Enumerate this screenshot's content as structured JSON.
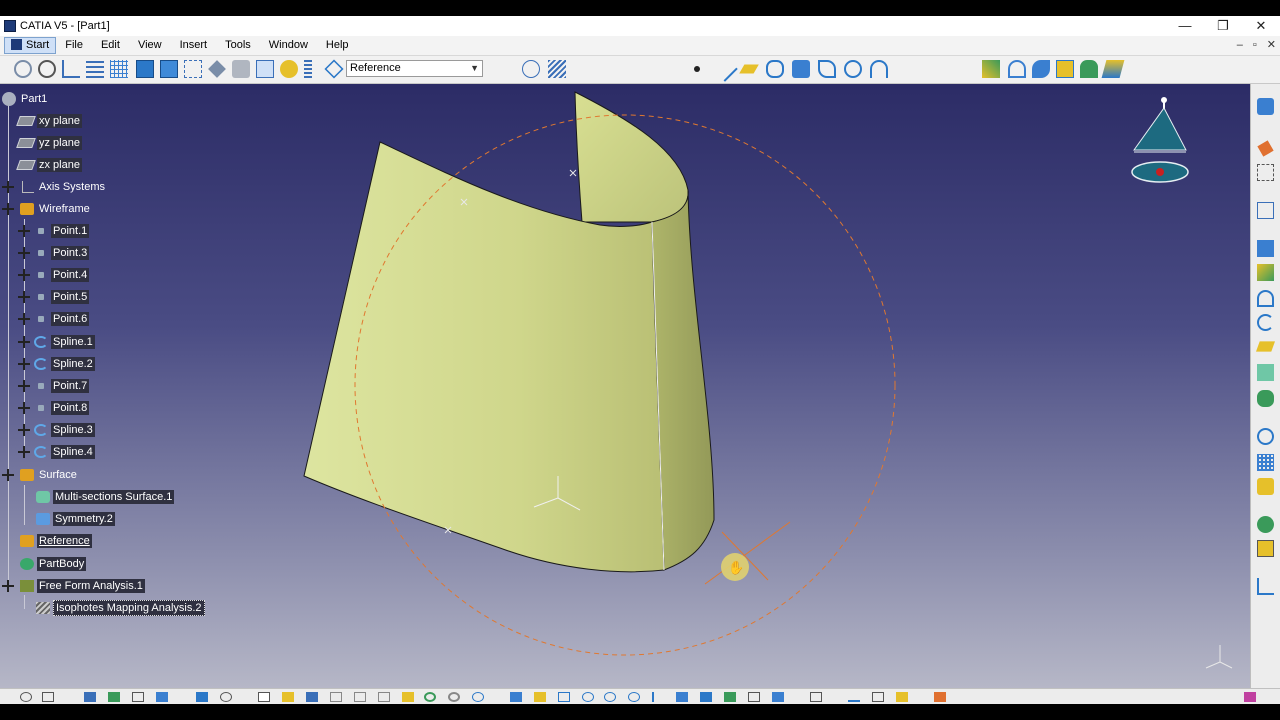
{
  "window": {
    "title": "CATIA V5 - [Part1]",
    "controls": [
      "—",
      "❐",
      "✕"
    ]
  },
  "menu": {
    "items": [
      "Start",
      "File",
      "Edit",
      "View",
      "Insert",
      "Tools",
      "Window",
      "Help"
    ],
    "inner_controls": [
      "–",
      "▫",
      "✕"
    ]
  },
  "toolbar": {
    "reference_select": "Reference"
  },
  "tree": {
    "root": "Part1",
    "nodes": [
      "xy plane",
      "yz plane",
      "zx plane",
      "Axis Systems",
      "Wireframe",
      "Point.1",
      "Point.3",
      "Point.4",
      "Point.5",
      "Point.6",
      "Spline.1",
      "Spline.2",
      "Point.7",
      "Point.8",
      "Spline.3",
      "Spline.4",
      "Surface",
      "Multi-sections Surface.1",
      "Symmetry.2",
      "Reference",
      "PartBody",
      "Free Form Analysis.1",
      "Isophotes Mapping Analysis.2"
    ]
  },
  "compass": {
    "axes": [
      "x",
      "y",
      "z"
    ]
  },
  "colors": {
    "surface": "#d6df95",
    "surface_shade": "#a8ae68",
    "analysis_circle": "#e07830",
    "viewport_top": "#2c2c66",
    "viewport_bottom": "#b6b7c7"
  }
}
